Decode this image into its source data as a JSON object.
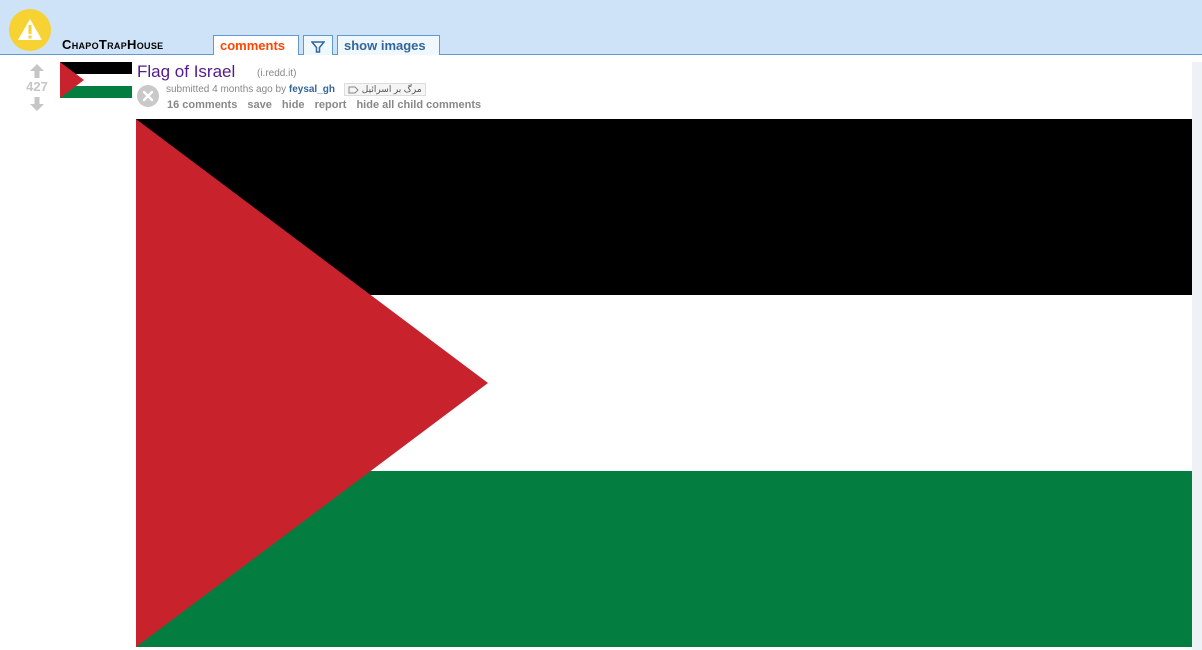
{
  "header": {
    "subreddit": "ChapoTrapHouse",
    "tabs": {
      "comments": "comments",
      "show_images": "show images"
    },
    "brand_color": "#cee3f8",
    "logo_color": "#f6d233"
  },
  "post": {
    "score": "427",
    "title": "Flag of Israel",
    "domain": "(i.redd.it)",
    "tagline_prefix": "submitted 4 months ago by ",
    "author": "feysal_gh",
    "flair": "مرگ بر اسرائیل",
    "buttons": {
      "comments": "16 comments",
      "save": "save",
      "hide": "hide",
      "report": "report",
      "hide_child": "hide all child comments"
    }
  },
  "image": {
    "colors": {
      "black": "#000000",
      "white": "#ffffff",
      "green": "#037d40",
      "red": "#c8232c"
    }
  },
  "icons": [
    "warning-icon",
    "filter-icon",
    "upvote-icon",
    "downvote-icon",
    "close-icon",
    "tag-icon"
  ]
}
